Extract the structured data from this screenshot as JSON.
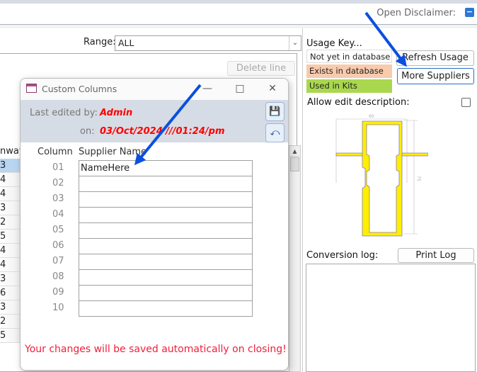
{
  "header": {
    "disclaimer_label": "Open Disclaimer:",
    "disclaimer_toggle": "−"
  },
  "main": {
    "range_label": "Range:",
    "range_value": "ALL",
    "delete_line_label": "Delete line",
    "grid_header": "nway",
    "grid_values": [
      "3",
      "4",
      "4",
      "3",
      "2",
      "5",
      "4",
      "4",
      "3",
      "6",
      "3",
      "2",
      "5"
    ]
  },
  "usage": {
    "title": "Usage Key...",
    "keys": [
      {
        "label": "Not yet in database",
        "color": "#ffffff"
      },
      {
        "label": "Exists in database",
        "color": "#f8cbad"
      },
      {
        "label": "Used in Kits",
        "color": "#a9d84e"
      }
    ],
    "refresh_label": "Refresh Usage",
    "more_suppliers_label": "More Suppliers",
    "allow_edit_label": "Allow edit description:",
    "allow_edit_checked": false,
    "profile_dims": {
      "width": "60",
      "height": "75"
    },
    "conversion_log_label": "Conversion log:",
    "print_log_label": "Print Log"
  },
  "dialog": {
    "title": "Custom Columns",
    "last_edited_label": "Last edited by:",
    "last_edited_value": "Admin",
    "on_label": "on:",
    "on_value": "03/Oct/2024 ///01:24/pm",
    "column_header": "Column",
    "supplier_header": "Supplier Name",
    "rows": [
      {
        "num": "01",
        "name": "NameHere"
      },
      {
        "num": "02",
        "name": ""
      },
      {
        "num": "03",
        "name": ""
      },
      {
        "num": "04",
        "name": ""
      },
      {
        "num": "05",
        "name": ""
      },
      {
        "num": "06",
        "name": ""
      },
      {
        "num": "07",
        "name": ""
      },
      {
        "num": "08",
        "name": ""
      },
      {
        "num": "09",
        "name": ""
      },
      {
        "num": "10",
        "name": ""
      }
    ],
    "footer": "Your changes will be saved automatically on closing!",
    "icons": [
      "save-icon",
      "undo-icon"
    ]
  },
  "colors": {
    "annotation_arrow": "#0a4fe0",
    "accent_red": "#ff0000"
  }
}
